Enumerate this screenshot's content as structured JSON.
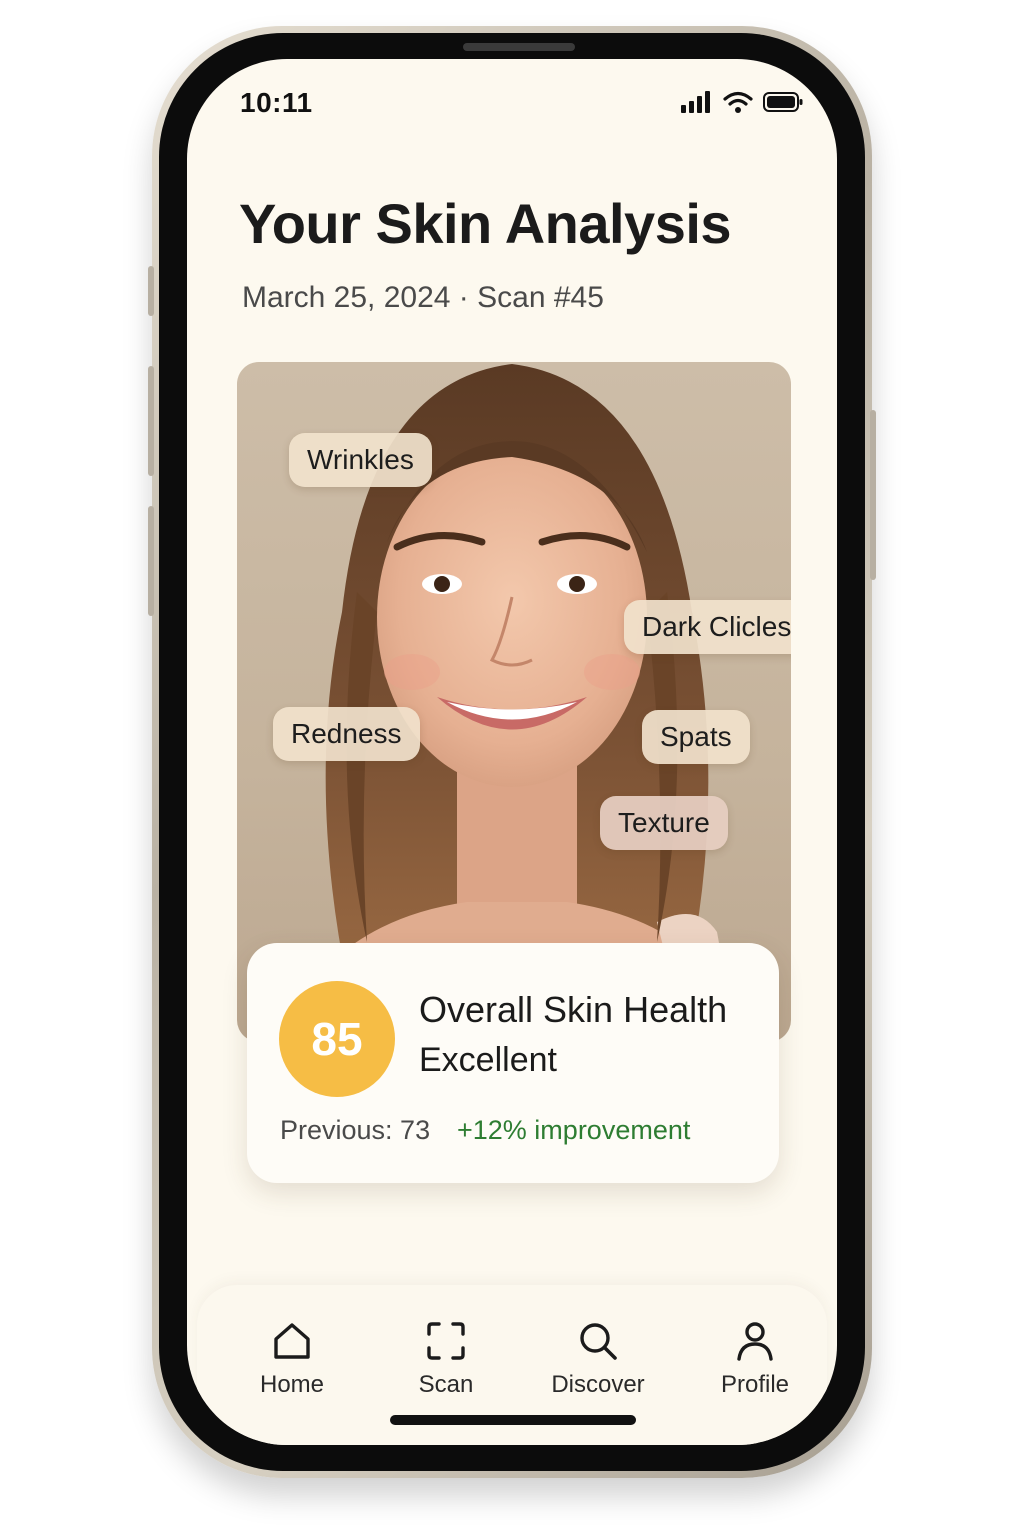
{
  "status_bar": {
    "time": "10:11",
    "icons": [
      "cellular-signal-icon",
      "wifi-icon",
      "battery-icon"
    ]
  },
  "header": {
    "title": "Your Skin Analysis",
    "subtitle": "March 25, 2024 · Scan #45"
  },
  "photo": {
    "description_icon": "face-photo",
    "tags": [
      {
        "label": "Wrinkles"
      },
      {
        "label": "Dark Clicles"
      },
      {
        "label": "Redness"
      },
      {
        "label": "Spats"
      },
      {
        "label": "Texture"
      }
    ]
  },
  "score_card": {
    "score": "85",
    "title": "Overall Skin Health",
    "rating": "Excellent",
    "previous": "Previous: 73",
    "improvement": "+12% improvement",
    "score_color": "#f6bd45",
    "improvement_color": "#2e7d32"
  },
  "nav": {
    "items": [
      {
        "label": "Home",
        "icon": "home-icon"
      },
      {
        "label": "Scan",
        "icon": "scan-icon"
      },
      {
        "label": "Discover",
        "icon": "search-icon"
      },
      {
        "label": "Profile",
        "icon": "profile-icon"
      }
    ]
  },
  "colors": {
    "background": "#fdf9ef",
    "accent": "#f6bd45",
    "positive": "#2e7d32"
  }
}
